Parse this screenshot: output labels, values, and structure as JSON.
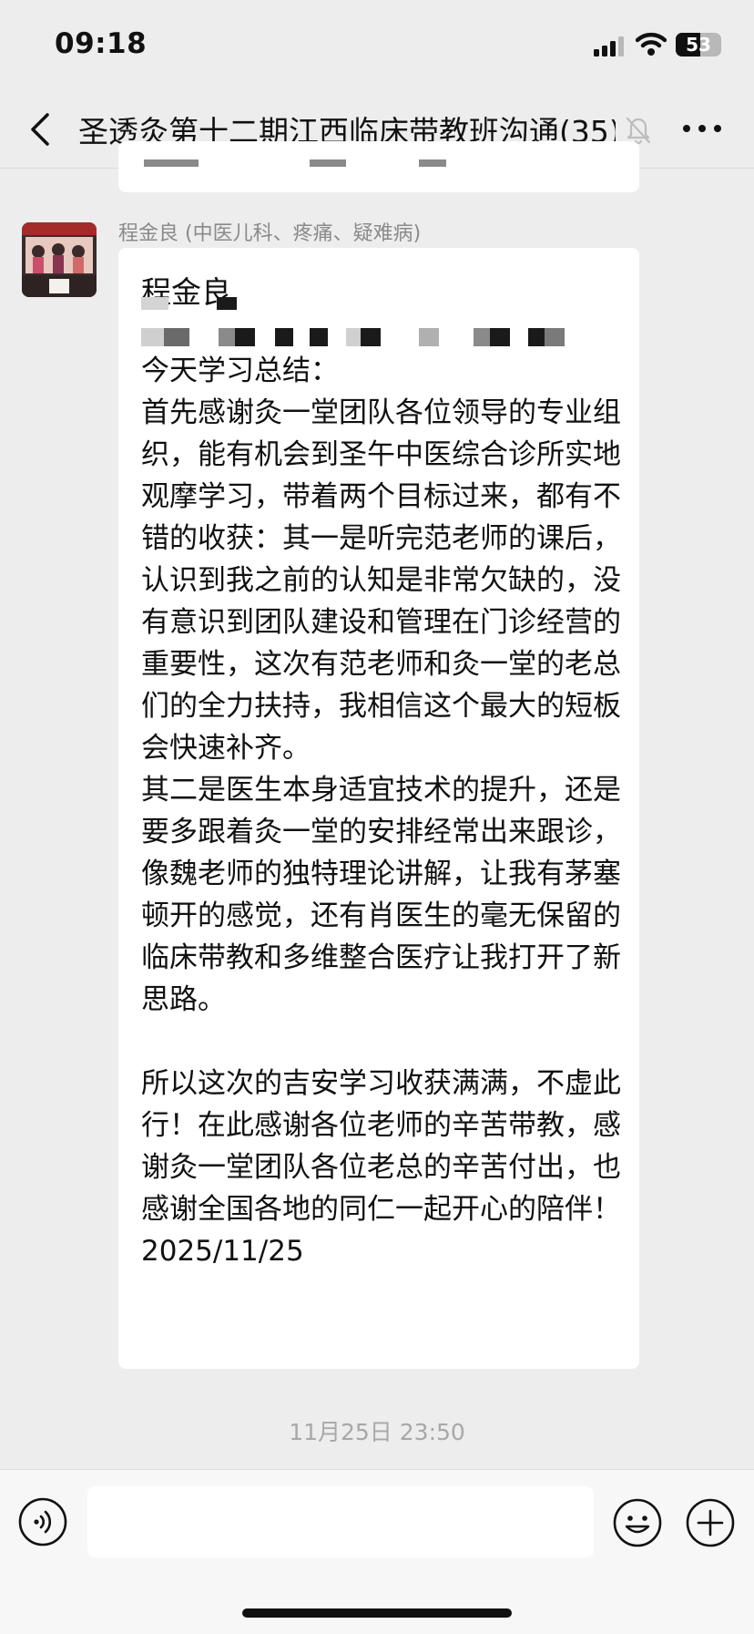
{
  "status_bar": {
    "time": "09:18",
    "battery": "53"
  },
  "header": {
    "title": "圣透灸第十二期江西临床带教班沟通(35)"
  },
  "message": {
    "sender_name": "程金良 (中医儿科、疼痛、疑难病)",
    "name_line": "程金良",
    "body": "今天学习总结：\n首先感谢灸一堂团队各位领导的专业组织，能有机会到圣午中医综合诊所实地观摩学习，带着两个目标过来，都有不错的收获：其一是听完范老师的课后，认识到我之前的认知是非常欠缺的，没有意识到团队建设和管理在门诊经营的重要性，这次有范老师和灸一堂的老总们的全力扶持，我相信这个最大的短板会快速补齐。\n其二是医生本身适宜技术的提升，还是要多跟着灸一堂的安排经常出来跟诊，像魏老师的独特理论讲解，让我有茅塞顿开的感觉，还有肖医生的毫无保留的临床带教和多维整合医疗让我打开了新思路。\n\n所以这次的吉安学习收获满满，不虚此行！在此感谢各位老师的辛苦带教，感谢灸一堂团队各位老总的辛苦付出，也感谢全国各地的同仁一起开心的陪伴！\n2025/11/25"
  },
  "timestamp": "11月25日 23:50",
  "icons": [
    "back-arrow-icon",
    "mute-bell-icon",
    "more-icon",
    "voice-icon",
    "emoji-icon",
    "plus-icon"
  ]
}
